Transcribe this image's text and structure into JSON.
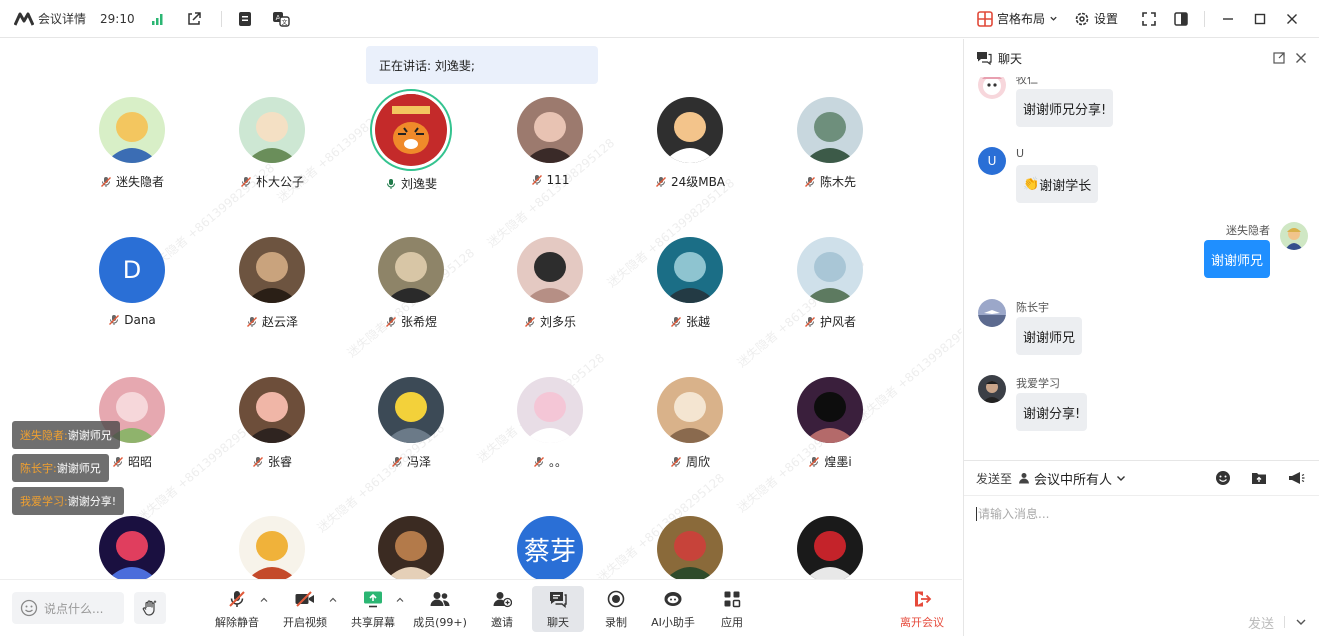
{
  "topbar": {
    "title": "会议详情",
    "timer": "29:10",
    "layout_label": "宫格布局",
    "settings_label": "设置"
  },
  "stage": {
    "speaking_label": "正在讲话: 刘逸斐;",
    "participants": [
      {
        "name": "迷失隐者",
        "muted": true
      },
      {
        "name": "朴大公子",
        "muted": true
      },
      {
        "name": "刘逸斐",
        "muted": false,
        "speaking": true
      },
      {
        "name": "111",
        "muted": true
      },
      {
        "name": "24级MBA",
        "muted": true
      },
      {
        "name": "陈木先",
        "muted": true
      },
      {
        "name": "Dana",
        "muted": true,
        "letter": "D"
      },
      {
        "name": "赵云泽",
        "muted": true
      },
      {
        "name": "张希煜",
        "muted": true
      },
      {
        "name": "刘多乐",
        "muted": true
      },
      {
        "name": "张越",
        "muted": true
      },
      {
        "name": "护风者",
        "muted": true
      },
      {
        "name": "昭昭",
        "muted": true
      },
      {
        "name": "张睿",
        "muted": true
      },
      {
        "name": "冯泽",
        "muted": true
      },
      {
        "name": "。。",
        "muted": true
      },
      {
        "name": "周欣",
        "muted": true
      },
      {
        "name": "煌墨i",
        "muted": true
      },
      {
        "name": "",
        "muted": true
      },
      {
        "name": "",
        "muted": true
      },
      {
        "name": "",
        "muted": true
      },
      {
        "name": "",
        "muted": true,
        "text_avatar": "蔡芽"
      },
      {
        "name": "",
        "muted": true
      },
      {
        "name": "",
        "muted": true
      }
    ],
    "float_messages": [
      {
        "who": "迷失隐者:",
        "text": "谢谢师兄"
      },
      {
        "who": "陈长宇:",
        "text": "谢谢师兄"
      },
      {
        "who": "我爱学习:",
        "text": "谢谢分享!"
      }
    ],
    "watermark": "迷失隐者 +8613998295128"
  },
  "toolbar": {
    "say_placeholder": "说点什么...",
    "items": [
      {
        "label": "解除静音"
      },
      {
        "label": "开启视频"
      },
      {
        "label": "共享屏幕"
      },
      {
        "label": "成员(99+)"
      },
      {
        "label": "邀请"
      },
      {
        "label": "聊天"
      },
      {
        "label": "录制"
      },
      {
        "label": "AI小助手"
      },
      {
        "label": "应用"
      }
    ],
    "leave_label": "离开会议"
  },
  "chat": {
    "title": "聊天",
    "messages": [
      {
        "sender": "牧仁",
        "text": "谢谢师兄分享!",
        "mine": false
      },
      {
        "sender": "U",
        "text": "谢谢学长",
        "emoji": "👏",
        "mine": false,
        "avatar_letter": "U"
      },
      {
        "sender": "迷失隐者",
        "text": "谢谢师兄",
        "mine": true
      },
      {
        "sender": "陈长宇",
        "text": "谢谢师兄",
        "mine": false
      },
      {
        "sender": "我爱学习",
        "text": "谢谢分享!",
        "mine": false
      }
    ],
    "send_to_label": "发送至",
    "send_target": "会议中所有人",
    "input_placeholder": "请输入消息...",
    "send_label": "发送"
  },
  "colors": {
    "accent": "#1f8fff",
    "speaking_ring": "#34c38f",
    "leave": "#e64a3b",
    "muted_mic": "#e05a3a"
  }
}
